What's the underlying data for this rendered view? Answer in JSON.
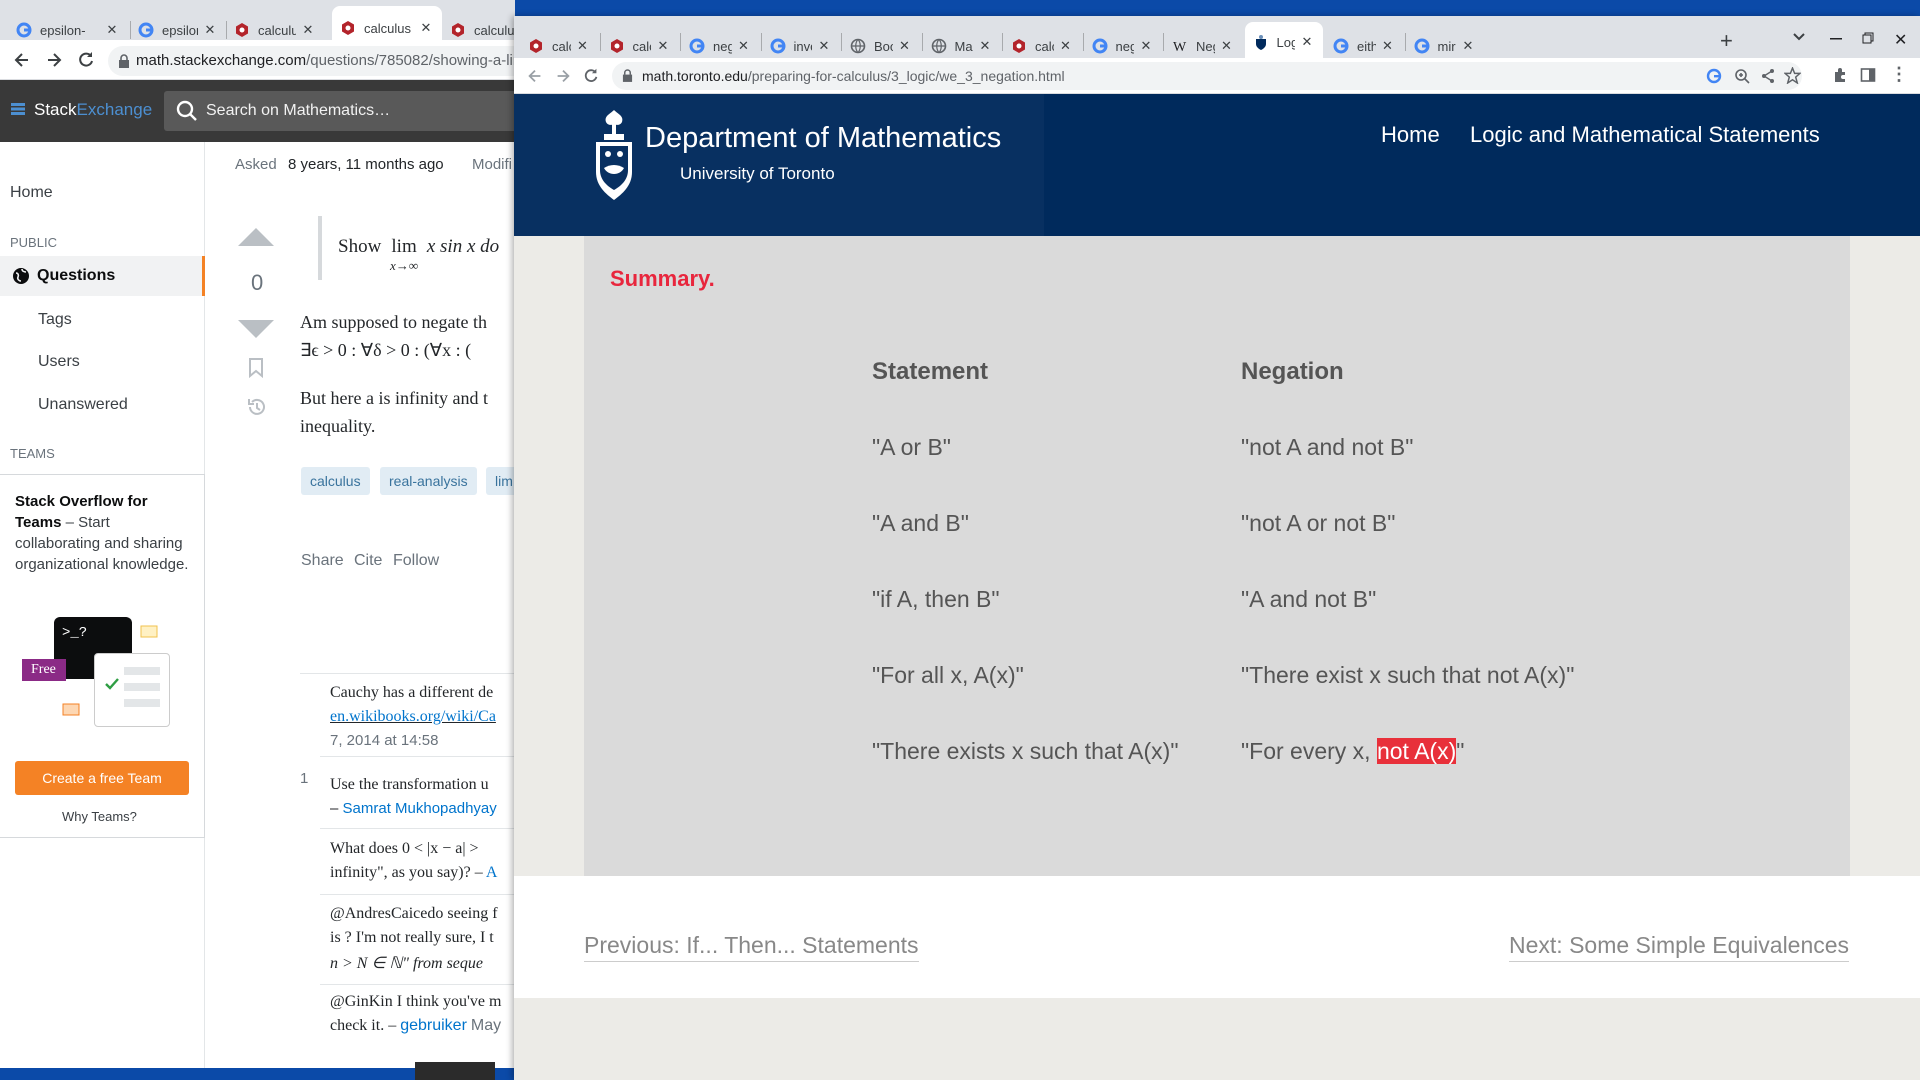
{
  "back_window": {
    "tabs": [
      {
        "label": "epsilon-",
        "icon": "google-icon"
      },
      {
        "label": "epsilon (",
        "icon": "google-icon"
      },
      {
        "label": "calculus",
        "icon": "stackexchange-math-icon"
      },
      {
        "label": "calculus",
        "icon": "stackexchange-math-icon"
      },
      {
        "label": "calculu",
        "icon": "stackexchange-math-icon"
      }
    ],
    "url": {
      "domain": "math.stackexchange.com",
      "path": "/questions/785082/showing-a-lin"
    },
    "header": {
      "logo_part1": "Stack",
      "logo_part2": "Exchange",
      "search_placeholder": "Search on Mathematics…"
    },
    "sidebar": {
      "home": "Home",
      "public_header": "PUBLIC",
      "questions": "Questions",
      "tags": "Tags",
      "users": "Users",
      "unanswered": "Unanswered",
      "teams_header": "TEAMS",
      "teams_title": "Stack Overflow for Teams",
      "teams_dash": " – Start collaborating and sharing organizational knowledge.",
      "free_badge": "Free",
      "terminal_text": ">_?",
      "create_team_button": "Create a free Team",
      "why_teams": "Why Teams?"
    },
    "question": {
      "asked_label": "Asked",
      "asked_value": "8 years, 11 months ago",
      "modified_label": "Modifi",
      "vote_count": "0",
      "quote_show": "Show",
      "quote_lim": "lim",
      "quote_sub": "x→∞",
      "quote_rest": "x sin x do",
      "body_line1": "Am supposed to negate th",
      "body_line2": "∃ϵ > 0 : ∀δ > 0 : (∀x : (",
      "body_line3": "But here a is infinity and t",
      "body_line4": "inequality.",
      "tags": [
        "calculus",
        "real-analysis",
        "lim"
      ],
      "actions": [
        "Share",
        "Cite",
        "Follow"
      ]
    },
    "comments": [
      {
        "score": "",
        "text": "Cauchy has a different de",
        "link": "en.wikibooks.org/wiki/Ca",
        "meta": "7, 2014 at 14:58"
      },
      {
        "score": "1",
        "text": "Use the transformation u",
        "author_prefix": "– ",
        "author": "Samrat Mukhopadhyay"
      },
      {
        "score": "",
        "text": "What does 0 < |x − a| >",
        "text2": "infinity\", as you say)? –",
        "author": "A"
      },
      {
        "score": "",
        "text": "@AndresCaicedo seeing f",
        "text2": "is ? I'm not really sure, I t",
        "text3": "n > N ∈ ℕ\" from seque"
      },
      {
        "score": "",
        "text": "@GinKin I think you've m",
        "text2": "check it. –",
        "author": "gebruiker",
        "meta": "May"
      }
    ]
  },
  "front_window": {
    "tabs": [
      {
        "label": "calcul",
        "icon": "stackexchange-math-icon"
      },
      {
        "label": "calcul",
        "icon": "stackexchange-math-icon"
      },
      {
        "label": "negati",
        "icon": "google-icon"
      },
      {
        "label": "invert",
        "icon": "google-icon"
      },
      {
        "label": "Book c",
        "icon": "globe-icon"
      },
      {
        "label": "Main p",
        "icon": "globe-icon"
      },
      {
        "label": "calcul",
        "icon": "stackexchange-math-icon"
      },
      {
        "label": "negati",
        "icon": "google-icon"
      },
      {
        "label": "Negat",
        "icon": "wikipedia-icon"
      },
      {
        "label": "Logic",
        "icon": "uoft-crest-icon",
        "active": true
      },
      {
        "label": "either",
        "icon": "google-icon"
      },
      {
        "label": "mirror",
        "icon": "google-icon"
      }
    ],
    "url": {
      "domain": "math.toronto.edu",
      "path": "/preparing-for-calculus/3_logic/we_3_negation.html"
    },
    "site": {
      "dept": "Department of Mathematics",
      "university": "University of Toronto",
      "nav": [
        "Home",
        "Logic and Mathematical Statements"
      ]
    },
    "summary_label": "Summary.",
    "table": {
      "headers": [
        "Statement",
        "Negation"
      ],
      "rows": [
        {
          "statement": "\"A or B\"",
          "negation": "\"not A and not B\""
        },
        {
          "statement": "\"A and B\"",
          "negation": "\"not A or not B\""
        },
        {
          "statement": "\"if A, then B\"",
          "negation": "\"A and not B\""
        },
        {
          "statement": "\"For all x, A(x)\"",
          "negation": "\"There exist x such that not A(x)\""
        },
        {
          "statement": "\"There exists x such that A(x)\"",
          "negation_prefix": "\"For every x, ",
          "negation_highlight": "not A(x)",
          "negation_suffix": "\""
        }
      ]
    },
    "pager": {
      "previous": "Previous: If... Then... Statements",
      "next": "Next: Some Simple Equivalences"
    }
  },
  "colors": {
    "ut_navy": "#002a5c",
    "summary_red": "#e8263d",
    "highlight_red": "#e8303a",
    "se_orange": "#f48225",
    "se_link": "#0074cc",
    "desktop_blue": "#0b4aa8"
  }
}
